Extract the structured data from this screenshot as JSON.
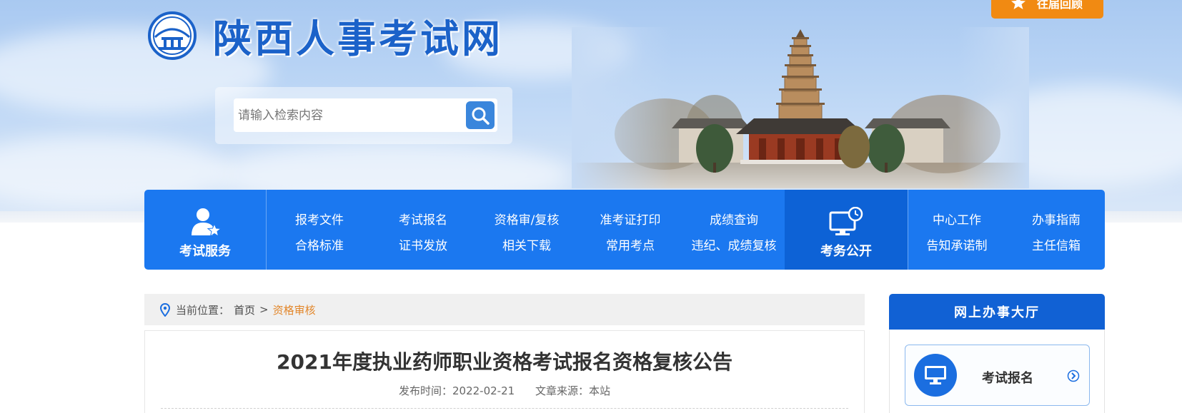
{
  "header": {
    "site_title": "陕西人事考试网",
    "review_button": "往届回顾",
    "search": {
      "placeholder": "请输入检索内容"
    }
  },
  "nav": {
    "exam_service": {
      "label": "考试服务",
      "icon": "person-star-icon"
    },
    "exam_affairs": {
      "label": "考务公开",
      "icon": "monitor-clock-icon"
    },
    "links_row1": [
      "报考文件",
      "考试报名",
      "资格审/复核",
      "准考证打印",
      "成绩查询"
    ],
    "links_row2": [
      "合格标准",
      "证书发放",
      "相关下载",
      "常用考点",
      "违纪、成绩复核"
    ],
    "right_row1": [
      "中心工作",
      "办事指南"
    ],
    "right_row2": [
      "告知承诺制",
      "主任信箱"
    ]
  },
  "breadcrumb": {
    "prefix": "当前位置：",
    "home": "首页",
    "separator": ">",
    "current": "资格审核"
  },
  "article": {
    "title": "2021年度执业药师职业资格考试报名资格复核公告",
    "publish_label": "发布时间：2022-02-21",
    "source_label": "文章来源：本站"
  },
  "sidebar": {
    "title": "网上办事大厅",
    "card": {
      "label": "考试报名",
      "icon": "monitor-icon"
    }
  },
  "colors": {
    "nav_blue": "#1b78f0",
    "nav_dark": "#0d62d6",
    "accent_orange": "#f18a12",
    "breadcrumb_current": "#e2862a"
  }
}
